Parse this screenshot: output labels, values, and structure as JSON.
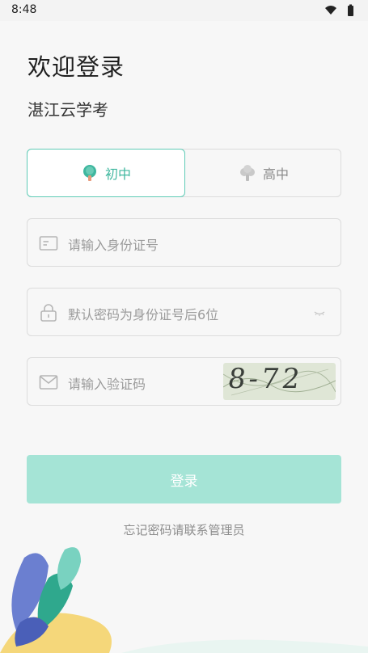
{
  "status_bar": {
    "time": "8:48",
    "icons": [
      "wifi-icon",
      "battery-icon"
    ]
  },
  "header": {
    "title": "欢迎登录",
    "subtitle": "湛江云学考"
  },
  "level_tabs": {
    "selected": "初中",
    "items": [
      {
        "label": "初中",
        "icon": "tree-icon",
        "active": true
      },
      {
        "label": "高中",
        "icon": "cloud-tree-icon",
        "active": false
      }
    ]
  },
  "form": {
    "id_field": {
      "placeholder": "请输入身份证号",
      "icon": "id-card-icon"
    },
    "password_field": {
      "placeholder": "默认密码为身份证号后6位",
      "icon": "lock-icon",
      "toggle_icon": "eye-closed-icon"
    },
    "captcha_field": {
      "placeholder": "请输入验证码",
      "icon": "mail-icon",
      "captcha_text": "8-72"
    }
  },
  "login_button": {
    "label": "登录"
  },
  "forgot_link": {
    "label": "忘记密码请联系管理员"
  },
  "colors": {
    "accent": "#3fb79f",
    "button": "#a5e4d6",
    "background": "#f7f7f7",
    "border": "#dcdcdc"
  }
}
